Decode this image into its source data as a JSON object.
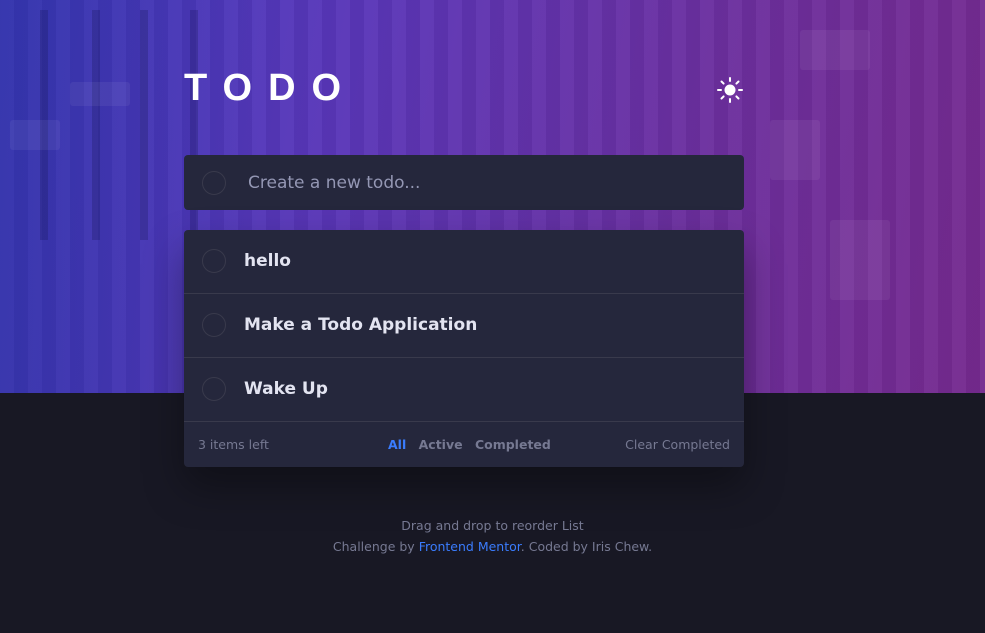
{
  "header": {
    "title": "TODO"
  },
  "new_todo": {
    "placeholder": "Create a new todo..."
  },
  "todos": [
    {
      "text": "hello",
      "completed": false
    },
    {
      "text": "Make a Todo Application",
      "completed": false
    },
    {
      "text": "Wake Up",
      "completed": false
    }
  ],
  "footer": {
    "items_left": "3 items left",
    "filters": {
      "all": "All",
      "active": "Active",
      "completed": "Completed"
    },
    "selected_filter": "All",
    "clear_label": "Clear Completed"
  },
  "hint": "Drag and drop to reorder List",
  "attribution": {
    "prefix": "Challenge by",
    "link_text": "Frontend Mentor",
    "suffix": ". Coded by Iris Chew."
  },
  "colors": {
    "accent": "#3a7cfd",
    "card": "#25273c",
    "background": "#181824"
  },
  "icons": {
    "theme_toggle": "sun-icon"
  }
}
